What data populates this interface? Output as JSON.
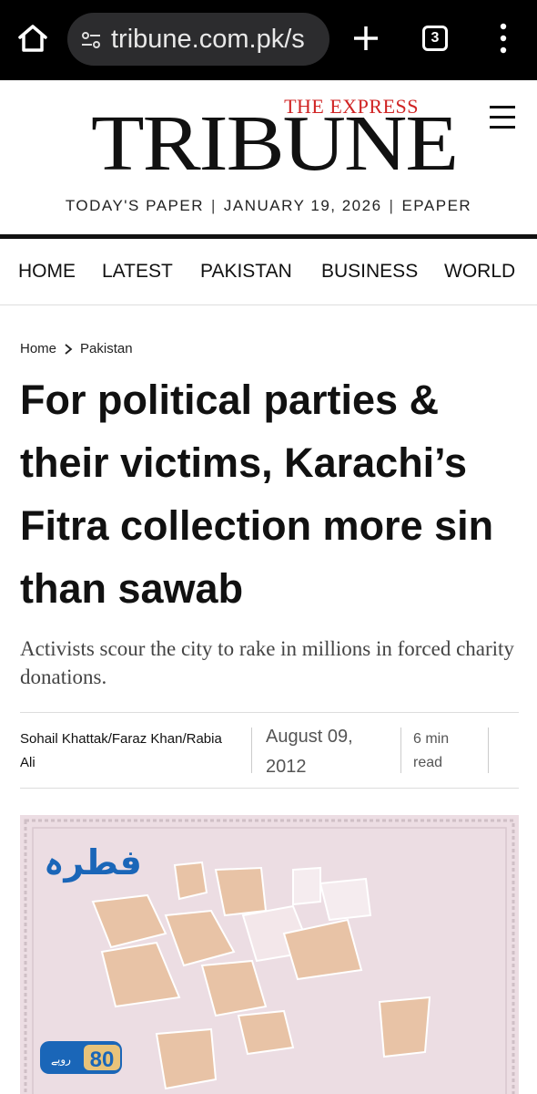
{
  "browser": {
    "url": "tribune.com.pk/s",
    "tab_count": "3"
  },
  "masthead": {
    "logo_top": "THE EXPRESS",
    "logo_main": "TRIBUNE",
    "todays_paper": "TODAY'S PAPER",
    "date": "JANUARY 19, 2026",
    "epaper": "EPAPER",
    "separator": "|"
  },
  "nav": {
    "items": [
      "HOME",
      "LATEST",
      "PAKISTAN",
      "BUSINESS",
      "WORLD"
    ]
  },
  "breadcrumb": {
    "home": "Home",
    "section": "Pakistan"
  },
  "article": {
    "headline": "For political parties & their victims, Karachi’s Fitra collection more sin than sawab",
    "subhead": "Activists scour the city to rake in millions in forced charity donations.",
    "authors": "Sohail Khattak/Faraz Khan/Rabia Ali",
    "date": "August 09, 2012",
    "read_time": "6 min read"
  },
  "photo": {
    "urdu_title": "فطرہ",
    "price": "80",
    "currency": "روپے"
  },
  "colors": {
    "express_red": "#d02323",
    "photo_bg": "#ecdde3",
    "urdu_blue": "#1a66b8",
    "paper_tan": "#e8c3a6"
  }
}
